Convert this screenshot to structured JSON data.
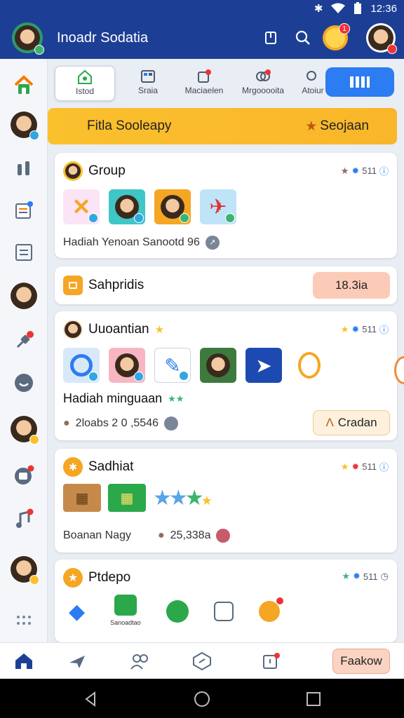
{
  "status_bar": {
    "time": "12:36"
  },
  "app_bar": {
    "title": "Inoadr Sodatia",
    "notification_count": "1"
  },
  "tabs": [
    {
      "label": "Istod",
      "active": true
    },
    {
      "label": "Sraia"
    },
    {
      "label": "Maciaelen"
    },
    {
      "label": "Mrgooooita"
    },
    {
      "label": "Atoiur"
    }
  ],
  "banner": {
    "left": "Fitla Sooleapy",
    "right": "Seojaan"
  },
  "cards": {
    "group": {
      "title": "Group",
      "meta": "511",
      "footer": "Hadiah  Yenoan  Sanootd  96"
    },
    "sahpridis": {
      "title": "Sahpridis",
      "pill": "18.3ia"
    },
    "uuoantian": {
      "title": "Uuoantian",
      "meta": "511",
      "subtitle": "Hadiah minguaan",
      "footer": "2loabs 2 0 ,5546",
      "button": "Cradan"
    },
    "sadhiat": {
      "title": "Sadhiat",
      "meta": "511",
      "footer_left": "Boanan  Nagy",
      "footer_value": "25,338a"
    },
    "ptdepo": {
      "title": "Ptdepo",
      "meta": "511",
      "caption": "Sanoadtao"
    }
  },
  "bottom_nav": {
    "button_label": "Faakow"
  },
  "colors": {
    "primary": "#1c3f95",
    "accent": "#fbc02d",
    "tab_toggle": "#2c7cf2",
    "badge": "#e33333"
  },
  "icons": [
    "home-icon",
    "search-icon",
    "bookmark-icon",
    "bell-icon",
    "star-icon",
    "gear-icon",
    "back-icon",
    "circle-home-icon",
    "recents-icon"
  ]
}
